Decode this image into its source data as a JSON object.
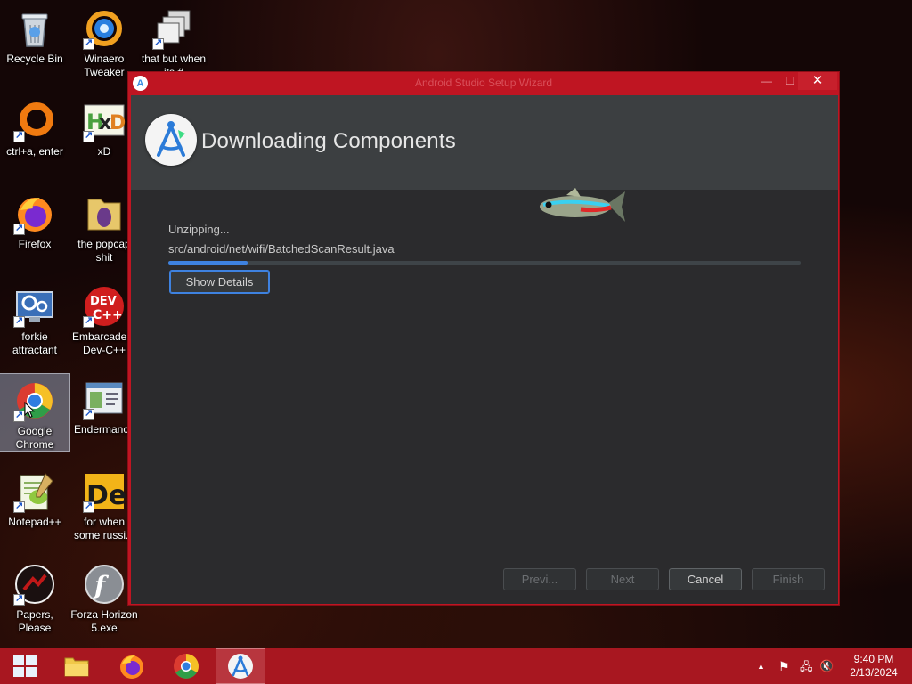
{
  "desktop": {
    "icons": [
      {
        "label": "Recycle Bin",
        "icon": "recycle-bin-icon"
      },
      {
        "label": "Winaero Tweaker",
        "icon": "winaero-tweaker-icon"
      },
      {
        "label": "that but when its #",
        "icon": "folder-stack-icon"
      },
      {
        "label": "ctrl+a, enter",
        "icon": "orange-ring-icon"
      },
      {
        "label": "xD",
        "icon": "hxd-icon"
      },
      {
        "label": "Firefox",
        "icon": "firefox-icon"
      },
      {
        "label": "the popcap shit",
        "icon": "folder-icon"
      },
      {
        "label": "forkie attractant",
        "icon": "monitor-gear-icon"
      },
      {
        "label": "Embarcadero Dev-C++",
        "icon": "dev-cpp-icon"
      },
      {
        "label": "Google Chrome",
        "icon": "chrome-icon"
      },
      {
        "label": "Endermanch",
        "icon": "window-app-icon"
      },
      {
        "label": "Notepad++",
        "icon": "notepad-plus-plus-icon"
      },
      {
        "label": "for when some russi...",
        "icon": "de-icon"
      },
      {
        "label": "Papers, Please",
        "icon": "papers-please-icon"
      },
      {
        "label": "Forza Horizon 5.exe",
        "icon": "flash-icon"
      }
    ]
  },
  "window": {
    "title": "Android Studio Setup Wizard",
    "header_title": "Downloading Components",
    "status_label": "Unzipping...",
    "file_path": "src/android/net/wifi/BatchedScanResult.java",
    "progress_percent": 12.5,
    "show_details_label": "Show Details",
    "buttons": {
      "previous": "Previ...",
      "next": "Next",
      "cancel": "Cancel",
      "finish": "Finish"
    },
    "close_glyph": "✕",
    "minimize_glyph": "—",
    "maximize_glyph": "☐",
    "title_icon_glyph": "A"
  },
  "taskbar": {
    "time": "9:40 PM",
    "date": "2/13/2024",
    "tray_chevron": "▲",
    "tray_flag": "⚑",
    "tray_network": "🖧",
    "tray_volume": "🔇"
  },
  "colors": {
    "window_border": "#bf1522",
    "taskbar": "#a81720",
    "client_bg": "#2b2b2d",
    "header_bg": "#3c3f41",
    "accent": "#3e82e0"
  }
}
